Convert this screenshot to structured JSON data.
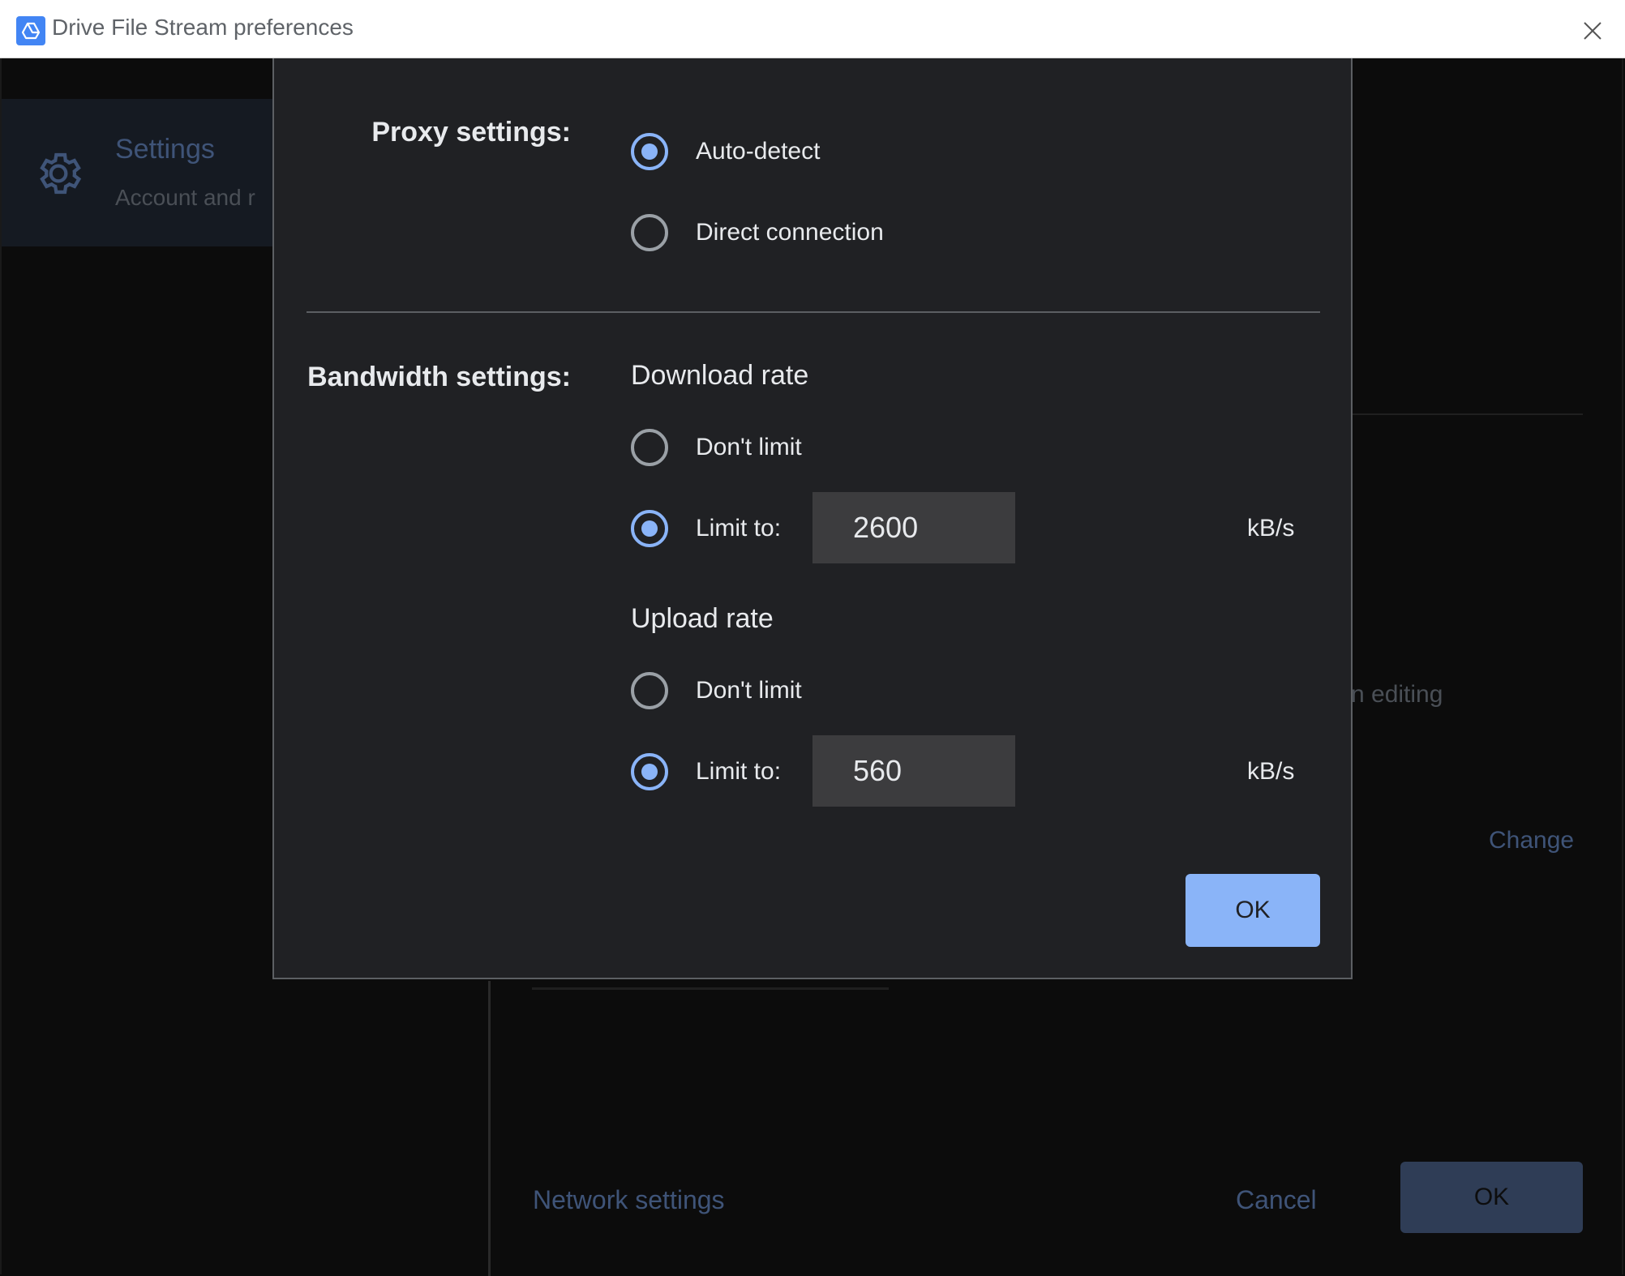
{
  "window": {
    "title": "Drive File Stream preferences"
  },
  "background": {
    "nav_item": {
      "title": "Settings",
      "subtitle": "Account and r"
    },
    "editing_fragment": "n editing",
    "change_link": "Change",
    "network_settings_link": "Network settings",
    "cancel_label": "Cancel",
    "ok_label": "OK"
  },
  "dialog": {
    "proxy": {
      "label": "Proxy settings:",
      "options": [
        {
          "label": "Auto-detect",
          "checked": true
        },
        {
          "label": "Direct connection",
          "checked": false
        }
      ]
    },
    "bandwidth": {
      "label": "Bandwidth settings:",
      "download": {
        "heading": "Download rate",
        "dont_limit_label": "Don't limit",
        "limit_label": "Limit to:",
        "selected": "limit",
        "value": "2600",
        "unit": "kB/s"
      },
      "upload": {
        "heading": "Upload rate",
        "dont_limit_label": "Don't limit",
        "limit_label": "Limit to:",
        "selected": "limit",
        "value": "560",
        "unit": "kB/s"
      }
    },
    "ok_label": "OK"
  },
  "colors": {
    "accent": "#8ab4f8",
    "dialog_bg": "#202124",
    "window_bg": "#0c0c0c"
  },
  "icons": {
    "app": "google-drive-icon",
    "close": "close-icon",
    "settings": "gear-icon"
  }
}
